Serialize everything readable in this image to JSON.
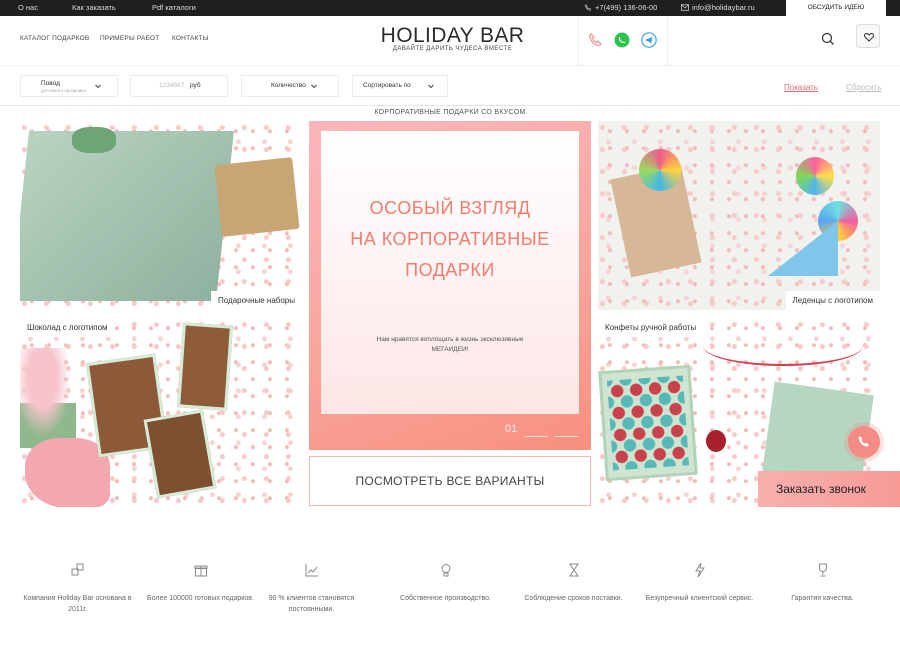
{
  "topbar": {
    "about": "О нас",
    "how_to_order": "Как заказать",
    "pdf": "Pdf каталоги",
    "phone": "+7(499) 136-06-00",
    "email": "info@holidaybar.ru",
    "discuss": "ОБСУДИТЬ ИДЕЮ"
  },
  "header": {
    "nav": [
      "КАТАЛОГ ПОДАРКОВ",
      "ПРИМЕРЫ РАБОТ",
      "КОНТАКТЫ"
    ],
    "logo_main": "HOLIDAY BAR",
    "logo_sub": "ДАВАЙТЕ ДАРИТЬ ЧУДЕСА ВМЕСТЕ"
  },
  "filters": {
    "occasion": "Повод",
    "occasion_sub": "для какого праздника",
    "price_placeholder": "1234567",
    "price_unit": "руб",
    "quantity": "Количество",
    "sort": "Сортировать по",
    "show": "Показать",
    "reset": "Сбросить"
  },
  "tagline": "КОРПОРАТИВНЫЕ ПОДАРКИ СО ВКУСОМ",
  "tiles": {
    "gift_sets": "Подарочные наборы",
    "lollipops": "Леденцы с логотипом",
    "chocolate": "Шоколад с логотипом",
    "candies": "Конфеты ручной работы"
  },
  "hero": {
    "line1": "ОСОБЫЙ ВЗГЛЯД",
    "line2": "НА КОРПОРАТИВНЫЕ",
    "line3": "ПОДАРКИ",
    "text": "Нам нравятся воплощать в жизнь эксклюзивные МЕГАИДЕИ!",
    "slide": "01"
  },
  "view_all": "ПОСМОТРЕТЬ ВСЕ ВАРИАНТЫ",
  "callback": "Заказать звонок",
  "features": [
    {
      "icon": "puzzle-icon",
      "text": "Компания Holiday Bar основана в 2011г."
    },
    {
      "icon": "gift-icon",
      "text": "Более 100000 готовых подарков."
    },
    {
      "icon": "chart-icon",
      "text": "90 % клиентов становятся постоянными."
    },
    {
      "icon": "lightbulb-icon",
      "text": "Собственное производство."
    },
    {
      "icon": "hourglass-icon",
      "text": "Соблюдение сроков поставки."
    },
    {
      "icon": "lightning-icon",
      "text": "Безупречный клиентский сервис."
    },
    {
      "icon": "trophy-icon",
      "text": "Гарантия качества."
    }
  ],
  "colors": {
    "accent": "#ef7e6f",
    "topbar": "#1f1f1f",
    "callback": "#f79a96"
  }
}
